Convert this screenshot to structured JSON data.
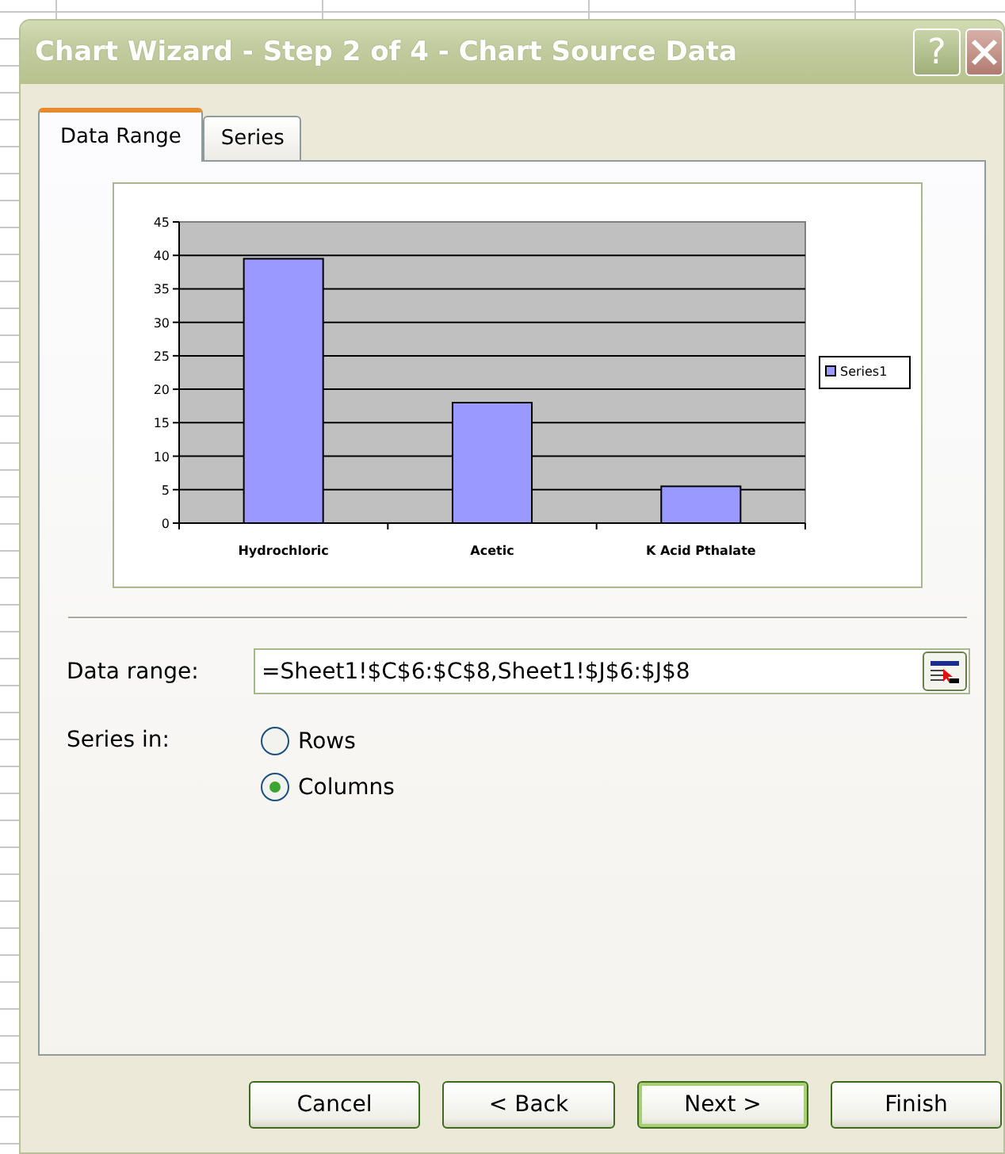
{
  "window": {
    "title": "Chart Wizard - Step 2 of 4 - Chart Source Data",
    "help_button": "?"
  },
  "tabs": [
    {
      "label": "Data Range",
      "selected": true
    },
    {
      "label": "Series",
      "selected": false
    }
  ],
  "chart": {
    "chart_data": {
      "type": "bar",
      "categories": [
        "Hydrochloric",
        "Acetic",
        "K Acid Pthalate"
      ],
      "series": [
        {
          "name": "Series1",
          "color": "#9999ff",
          "values": [
            39.5,
            18,
            5.5
          ]
        }
      ],
      "ylim": [
        0,
        45
      ],
      "grid": true,
      "yticks": [
        0,
        5,
        10,
        15,
        20,
        25,
        30,
        35,
        40,
        45
      ]
    }
  },
  "data_range": {
    "label": "Data range:",
    "value": "=Sheet1!$C$6:$C$8,Sheet1!$J$6:$J$8"
  },
  "series_in": {
    "label": "Series in:",
    "options": [
      {
        "label": "Rows",
        "selected": false
      },
      {
        "label": "Columns",
        "selected": true
      }
    ]
  },
  "buttons": [
    {
      "label": "Cancel",
      "default": false
    },
    {
      "label": "< Back",
      "default": false
    },
    {
      "label": "Next >",
      "default": true
    },
    {
      "label": "Finish",
      "default": false
    }
  ]
}
